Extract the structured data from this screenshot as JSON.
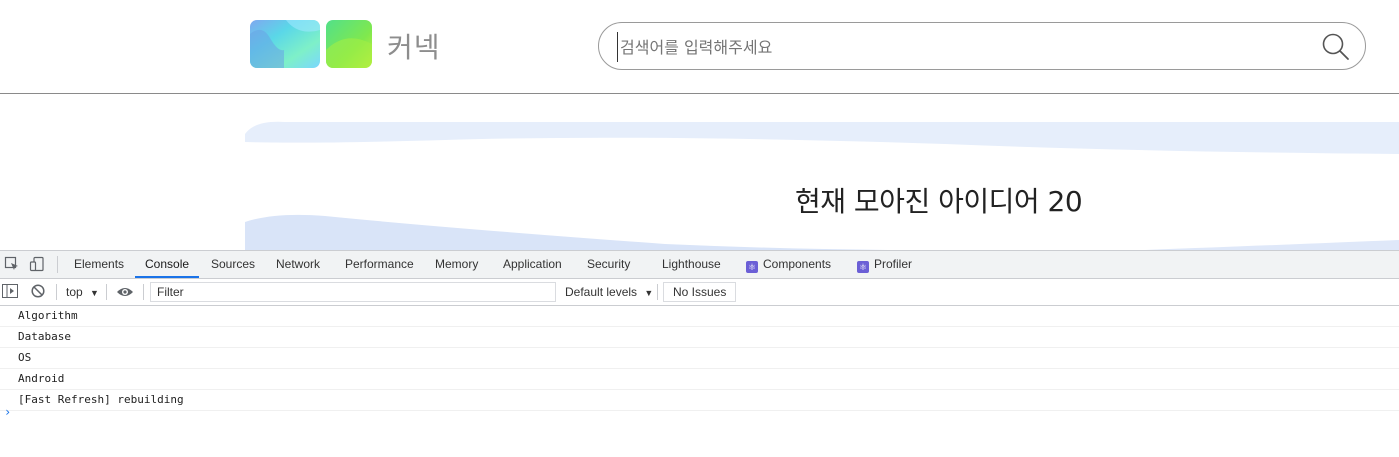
{
  "header": {
    "logo_text": "커넥",
    "search": {
      "placeholder": "검색어를 입력해주세요",
      "value": ""
    }
  },
  "hero": {
    "title": "현재 모아진 아이디어 20"
  },
  "devtools": {
    "tabs": [
      {
        "label": "Elements",
        "active": false
      },
      {
        "label": "Console",
        "active": true
      },
      {
        "label": "Sources",
        "active": false
      },
      {
        "label": "Network",
        "active": false
      },
      {
        "label": "Performance",
        "active": false
      },
      {
        "label": "Memory",
        "active": false
      },
      {
        "label": "Application",
        "active": false
      },
      {
        "label": "Security",
        "active": false
      },
      {
        "label": "Lighthouse",
        "active": false
      },
      {
        "label": "Components",
        "active": false,
        "icon": "react-icon"
      },
      {
        "label": "Profiler",
        "active": false,
        "icon": "react-icon"
      }
    ],
    "toolbar": {
      "context": "top",
      "filter_placeholder": "Filter",
      "levels": "Default levels",
      "issues": "No Issues"
    },
    "console_lines": [
      "Algorithm",
      "Database",
      "OS",
      "Android",
      "[Fast Refresh] rebuilding"
    ],
    "prompt_symbol": "›"
  },
  "colors": {
    "accent": "#1a73e8",
    "wave_light": "#e6eefb",
    "wave_mid": "#d3e0f7",
    "react_badge": "#6b5fd6"
  }
}
